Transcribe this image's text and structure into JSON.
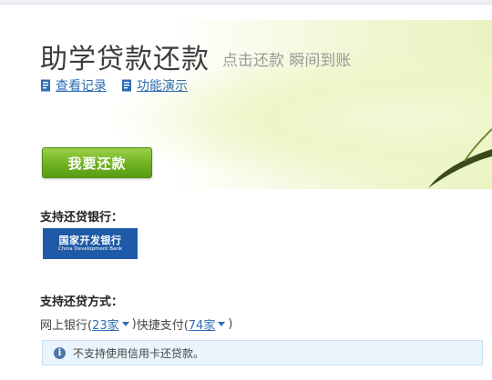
{
  "header": {
    "title": "助学贷款还款",
    "subtitle": "点击还款 瞬间到账"
  },
  "links": [
    {
      "label": "查看记录",
      "icon": "document-icon"
    },
    {
      "label": "功能演示",
      "icon": "document-icon"
    }
  ],
  "pay_button": {
    "label": "我要还款"
  },
  "banks": {
    "label": "支持还贷银行：",
    "logo": {
      "name_cn": "国家开发银行",
      "name_en": "China Development Bank"
    }
  },
  "methods": {
    "label": "支持还贷方式：",
    "online_banking": {
      "prefix": "网上银行(",
      "count": "23家",
      "suffix": ")"
    },
    "quick_pay": {
      "prefix": "快捷支付(",
      "count": "74家",
      "suffix": ")"
    }
  },
  "notice": {
    "text": "不支持使用信用卡还贷款。",
    "icon": "info-icon"
  },
  "colors": {
    "accent_blue": "#2d6cb4",
    "button_green": "#6fb21f",
    "bank_blue": "#1f5aa8"
  }
}
